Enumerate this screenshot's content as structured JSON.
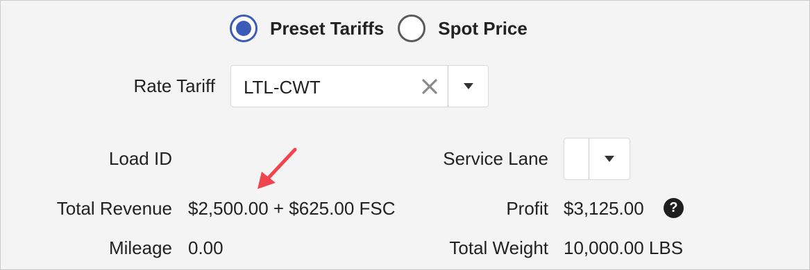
{
  "pricing_mode": {
    "options": [
      {
        "label": "Preset Tariffs",
        "selected": true
      },
      {
        "label": "Spot Price",
        "selected": false
      }
    ]
  },
  "rate_tariff": {
    "label": "Rate Tariff",
    "value": "LTL-CWT"
  },
  "load_id": {
    "label": "Load ID",
    "value": ""
  },
  "service_lane": {
    "label": "Service Lane",
    "value": ""
  },
  "total_revenue": {
    "label": "Total Revenue",
    "value": "$2,500.00 + $625.00 FSC"
  },
  "profit": {
    "label": "Profit",
    "value": "$3,125.00",
    "help_glyph": "?"
  },
  "mileage": {
    "label": "Mileage",
    "value": "0.00"
  },
  "total_weight": {
    "label": "Total Weight",
    "value": "10,000.00 LBS"
  },
  "colors": {
    "accent": "#3b5bb8",
    "annotation_arrow": "#f0444f",
    "panel_bg": "#f4f4f4"
  },
  "icons": {
    "clear": "close-icon",
    "dropdown": "chevron-down-icon",
    "help": "help-icon",
    "annotation": "arrow-icon"
  }
}
